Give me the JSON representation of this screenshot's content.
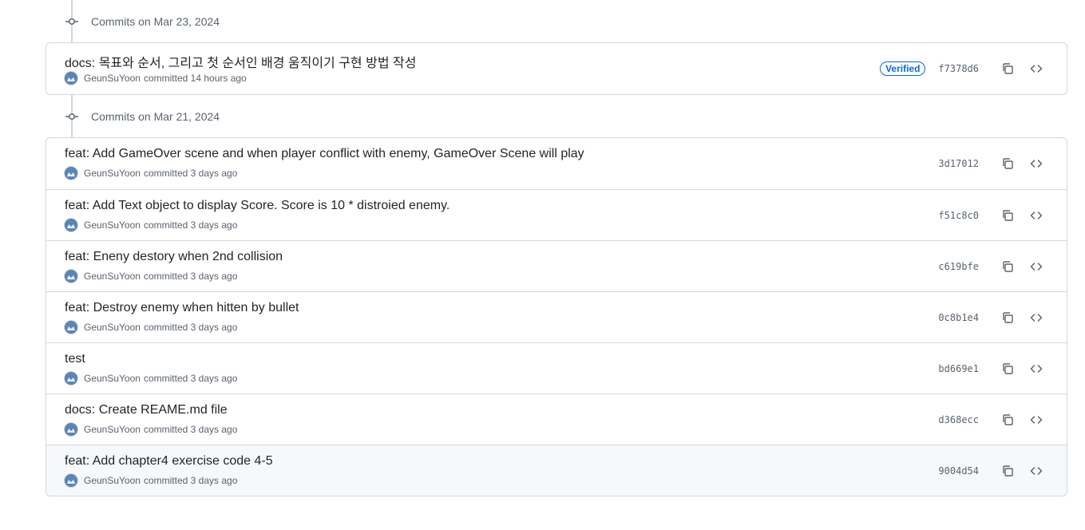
{
  "groups": [
    {
      "date_label": "Commits on Mar 23, 2024",
      "commits": [
        {
          "message": "docs: 목표와 순서, 그리고 첫 순서인 배경 움직이기 구현 방법 작성",
          "author": "GeunSuYoon",
          "action": "committed",
          "time": "14 hours ago",
          "badge": "Verified",
          "sha": "f7378d6"
        }
      ]
    },
    {
      "date_label": "Commits on Mar 21, 2024",
      "commits": [
        {
          "message": "feat: Add GameOver scene and when player conflict with enemy, GameOver Scene will play",
          "author": "GeunSuYoon",
          "action": "committed",
          "time": "3 days ago",
          "sha": "3d17012"
        },
        {
          "message": "feat: Add Text object to display Score. Score is 10 * distroied enemy.",
          "author": "GeunSuYoon",
          "action": "committed",
          "time": "3 days ago",
          "sha": "f51c8c0"
        },
        {
          "message": "feat: Eneny destory when 2nd collision",
          "author": "GeunSuYoon",
          "action": "committed",
          "time": "3 days ago",
          "sha": "c619bfe"
        },
        {
          "message": "feat: Destroy enemy when hitten by bullet",
          "author": "GeunSuYoon",
          "action": "committed",
          "time": "3 days ago",
          "sha": "0c8b1e4"
        },
        {
          "message": "test",
          "author": "GeunSuYoon",
          "action": "committed",
          "time": "3 days ago",
          "sha": "bd669e1"
        },
        {
          "message": "docs: Create REAME.md file",
          "author": "GeunSuYoon",
          "action": "committed",
          "time": "3 days ago",
          "sha": "d368ecc"
        },
        {
          "message": "feat: Add chapter4 exercise code 4-5",
          "author": "GeunSuYoon",
          "action": "committed",
          "time": "3 days ago",
          "sha": "9004d54"
        }
      ]
    }
  ],
  "icons": {
    "commit_node": "git-commit-icon",
    "copy": "copy-icon",
    "browse": "code-icon"
  },
  "colors": {
    "verified": "#0969da",
    "border": "#d0d7de",
    "muted_text": "#59636e",
    "hover_row": "#f6f8fa"
  }
}
